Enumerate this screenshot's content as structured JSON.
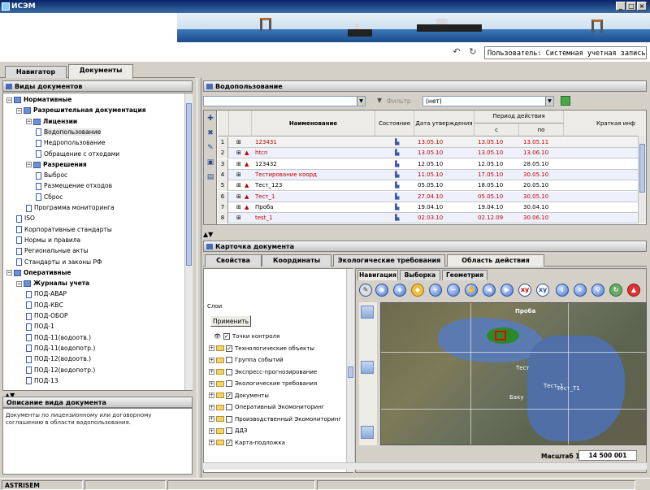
{
  "app": {
    "title": "ИСЭМ",
    "user_label": "Пользователь: Системная учетная запись С.С."
  },
  "tabs": {
    "navigator": "Навигатор",
    "documents": "Документы"
  },
  "left_panel": {
    "header": "Виды документов",
    "tree": [
      {
        "label": "Нормативные",
        "bold": true,
        "level": 0,
        "toggle": "−",
        "icon": "folder"
      },
      {
        "label": "Разрешительная документация",
        "bold": true,
        "level": 1,
        "toggle": "−",
        "icon": "folder"
      },
      {
        "label": "Лицензии",
        "bold": true,
        "level": 2,
        "toggle": "−",
        "icon": "folder"
      },
      {
        "label": "Водопользование",
        "level": 3,
        "icon": "doc",
        "selected": true
      },
      {
        "label": "Недропользование",
        "level": 3,
        "icon": "doc"
      },
      {
        "label": "Обращение с отходами",
        "level": 3,
        "icon": "doc"
      },
      {
        "label": "Разрешения",
        "bold": true,
        "level": 2,
        "toggle": "−",
        "icon": "folder"
      },
      {
        "label": "Выброс",
        "level": 3,
        "icon": "doc"
      },
      {
        "label": "Размещение отходов",
        "level": 3,
        "icon": "doc"
      },
      {
        "label": "Сброс",
        "level": 3,
        "icon": "doc"
      },
      {
        "label": "Программа мониторинга",
        "level": 2,
        "icon": "doc"
      },
      {
        "label": "ISO",
        "level": 1,
        "icon": "doc"
      },
      {
        "label": "Корпоративные стандарты",
        "level": 1,
        "icon": "doc"
      },
      {
        "label": "Нормы и правила",
        "level": 1,
        "icon": "doc"
      },
      {
        "label": "Региональные акты",
        "level": 1,
        "icon": "doc"
      },
      {
        "label": "Стандарты и законы РФ",
        "level": 1,
        "icon": "doc"
      },
      {
        "label": "Оперативные",
        "bold": true,
        "level": 0,
        "toggle": "−",
        "icon": "folder"
      },
      {
        "label": "Журналы учета",
        "bold": true,
        "level": 1,
        "toggle": "−",
        "icon": "folder"
      },
      {
        "label": "ПОД-АВАР",
        "level": 2,
        "icon": "doc"
      },
      {
        "label": "ПОД-КВС",
        "level": 2,
        "icon": "doc"
      },
      {
        "label": "ПОД-ОБОР",
        "level": 2,
        "icon": "doc"
      },
      {
        "label": "ПОД-1",
        "level": 2,
        "icon": "doc"
      },
      {
        "label": "ПОД-11(водоотв.)",
        "level": 2,
        "icon": "doc"
      },
      {
        "label": "ПОД-11(водопотр.)",
        "level": 2,
        "icon": "doc"
      },
      {
        "label": "ПОД-12(водоотв.)",
        "level": 2,
        "icon": "doc"
      },
      {
        "label": "ПОД-12(водопотр.)",
        "level": 2,
        "icon": "doc"
      },
      {
        "label": "ПОД-13",
        "level": 2,
        "icon": "doc"
      }
    ],
    "desc_header": "Описание вида документа",
    "desc_text": "Документы по лицензионному или договорному соглашению в области водопользования."
  },
  "grid_panel": {
    "header": "Водопользование",
    "filter_label": "Фильтр",
    "filter_value": "(нет)",
    "columns": {
      "name": "Наименование",
      "state": "Состояние",
      "date": "Дата утверждения",
      "period": "Период действия",
      "from": "с",
      "to": "по",
      "short": "Краткая инф"
    },
    "rows": [
      {
        "n": "1",
        "name": "123431",
        "date": "13.05.10",
        "from": "13.05.10",
        "to": "13.05.11",
        "red": true,
        "pdf": false
      },
      {
        "n": "2",
        "name": "htcn",
        "date": "13.05.10",
        "from": "13.05.10",
        "to": "13.06.10",
        "red": true,
        "pdf": true
      },
      {
        "n": "3",
        "name": "123432",
        "date": "12.05.10",
        "from": "12.05.10",
        "to": "28.05.10",
        "red": false,
        "pdf": true
      },
      {
        "n": "4",
        "name": "Тестирование коорд",
        "date": "11.05.10",
        "from": "17.05.10",
        "to": "30.05.10",
        "red": true,
        "pdf": false
      },
      {
        "n": "5",
        "name": "Тест_123",
        "date": "05.05.10",
        "from": "18.05.10",
        "to": "20.05.10",
        "red": false,
        "pdf": true
      },
      {
        "n": "6",
        "name": "Тест_1",
        "date": "27.04.10",
        "from": "05.05.10",
        "to": "30.05.10",
        "red": true,
        "pdf": true
      },
      {
        "n": "7",
        "name": "Проба",
        "date": "19.04.10",
        "from": "19.04.10",
        "to": "30.04.10",
        "red": false,
        "pdf": true
      },
      {
        "n": "8",
        "name": "test_1",
        "date": "02.03.10",
        "from": "02.12.09",
        "to": "30.06.10",
        "red": true,
        "pdf": false
      }
    ]
  },
  "card": {
    "header": "Карточка документа",
    "tabs": [
      "Свойства",
      "Координаты",
      "Экологические требования",
      "Область действия"
    ],
    "map_tabs": [
      "Навигация",
      "Выборка",
      "Геометрия"
    ],
    "layers_title": "Слои",
    "apply": "Применить",
    "layers": [
      {
        "label": "Точки контроля",
        "checked": true,
        "toggle": false
      },
      {
        "label": "Технологические объекты",
        "checked": true,
        "toggle": true
      },
      {
        "label": "Группа событий",
        "checked": false,
        "toggle": true
      },
      {
        "label": "Экспресс-прогнозирование",
        "checked": false,
        "toggle": true
      },
      {
        "label": "Экологические требования",
        "checked": false,
        "toggle": true
      },
      {
        "label": "Документы",
        "checked": true,
        "toggle": true
      },
      {
        "label": "Оперативный Экомониторинг",
        "checked": false,
        "toggle": true
      },
      {
        "label": "Производственный Экомониторинг",
        "checked": false,
        "toggle": true
      },
      {
        "label": "ДДЗ",
        "checked": false,
        "toggle": true
      },
      {
        "label": "Карта-подложка",
        "checked": true,
        "toggle": true
      }
    ],
    "map_labels": [
      "Тест",
      "Тест_1",
      "Тест_Т1",
      "Баку",
      "Проба"
    ],
    "scale_label": "Масштаб 1:",
    "scale_value": "14 500 001"
  },
  "status": {
    "app": "ASTRISEM"
  },
  "colors": {
    "title_bar": "#0a246a",
    "selection": "#e7e7e7",
    "red_text": "#c00000",
    "alt_row": "#eef0fb"
  }
}
